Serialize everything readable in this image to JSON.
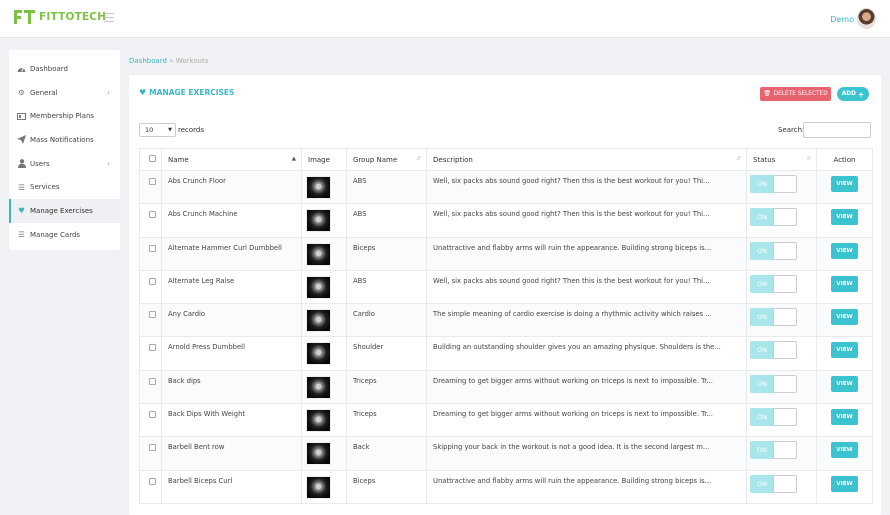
{
  "header": {
    "brand": "FITTOTECH",
    "user_name": "Demo"
  },
  "sidebar": {
    "items": [
      {
        "label": "Dashboard",
        "icon": "dashboard-icon",
        "chev": ""
      },
      {
        "label": "General",
        "icon": "cogs-icon",
        "chev": "‹"
      },
      {
        "label": "Membership Plans",
        "icon": "id-card-icon",
        "chev": ""
      },
      {
        "label": "Mass Notifications",
        "icon": "paper-plane-icon",
        "chev": ""
      },
      {
        "label": "Users",
        "icon": "user-icon",
        "chev": "‹"
      },
      {
        "label": "Services",
        "icon": "list-icon",
        "chev": ""
      },
      {
        "label": "Manage Exercises",
        "icon": "heartbeat-icon",
        "chev": ""
      },
      {
        "label": "Manage Cards",
        "icon": "list-icon",
        "chev": ""
      }
    ]
  },
  "breadcrumb": {
    "home": "Dashboard",
    "separator": "»",
    "current": "Workouts"
  },
  "card": {
    "title": "MANAGE EXERCISES",
    "delete_label": "DELETE SELECTED",
    "add_label": "ADD",
    "length_value": "10",
    "length_label": "records",
    "search_label": "Search:"
  },
  "table": {
    "columns": [
      "",
      "Name",
      "Image",
      "Group Name",
      "Description",
      "Status",
      "Action"
    ],
    "status_label": "ON",
    "view_label": "VIEW",
    "rows": [
      {
        "name": "Abs Crunch Floor",
        "group": "ABS",
        "description": "Well, six packs abs sound good right? Then this is the best workout for you! Thi..."
      },
      {
        "name": "Abs Crunch Machine",
        "group": "ABS",
        "description": "Well, six packs abs sound good right? Then this is the best workout for you! Thi..."
      },
      {
        "name": "Alternate Hammer Curl Dumbbell",
        "group": "Biceps",
        "description": "Unattractive and flabby arms will ruin the appearance. Building strong biceps is..."
      },
      {
        "name": "Alternate Leg Raise",
        "group": "ABS",
        "description": "Well, six packs abs sound good right? Then this is the best workout for you! Thi..."
      },
      {
        "name": "Any Cardio",
        "group": "Cardio",
        "description": "The simple meaning of cardio exercise is doing a rhythmic activity which raises ..."
      },
      {
        "name": "Arnold Press Dumbbell",
        "group": "Shoulder",
        "description": "Building an outstanding shoulder gives you an amazing physique. Shoulders is the..."
      },
      {
        "name": "Back dips",
        "group": "Triceps",
        "description": "Dreaming to get bigger arms without working on triceps is next to impossible. Tr..."
      },
      {
        "name": "Back Dips With Weight",
        "group": "Triceps",
        "description": "Dreaming to get bigger arms without working on triceps is next to impossible. Tr..."
      },
      {
        "name": "Barbell Bent row",
        "group": "Back",
        "description": "Skipping your back in the workout is not a good idea. It is the second largest m..."
      },
      {
        "name": "Barbell Biceps Curl",
        "group": "Biceps",
        "description": "Unattractive and flabby arms will ruin the appearance. Building strong biceps is..."
      }
    ]
  },
  "colors": {
    "brand_green": "#7cc242",
    "accent_teal": "#3bc3cf",
    "danger": "#e8636d"
  }
}
